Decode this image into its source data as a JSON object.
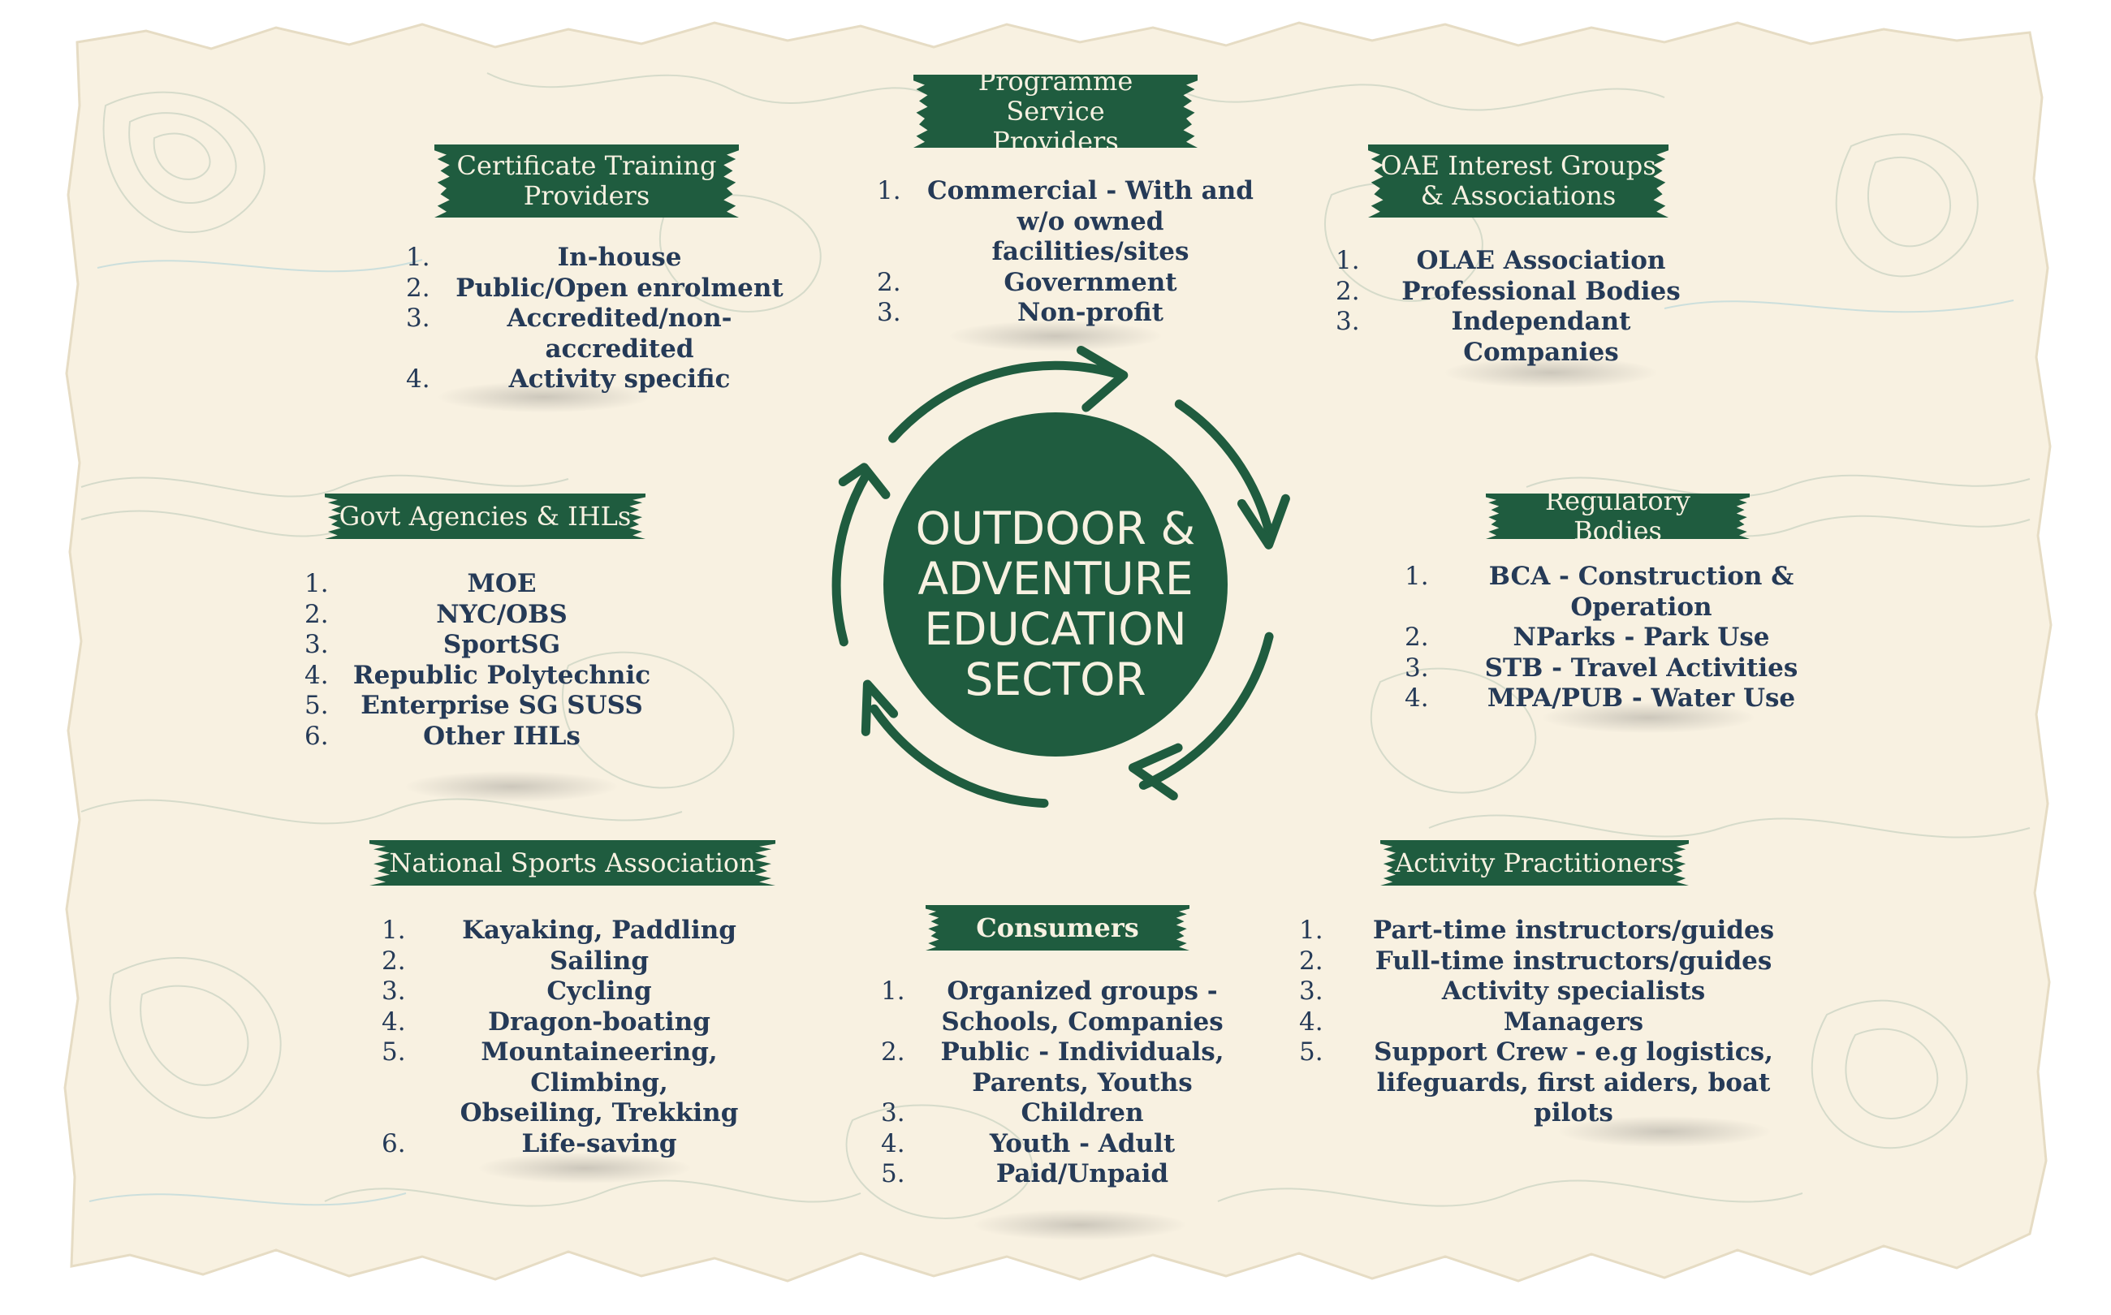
{
  "colors": {
    "paper": "#f8f1e1",
    "banner": "#1f5c3f",
    "text": "#253a57",
    "banner_text": "#f7f1e1",
    "contour": "#b9c9b8"
  },
  "center": {
    "title": "OUTDOOR &\nADVENTURE\nEDUCATION\nSECTOR"
  },
  "groups": {
    "programme": {
      "title": "Programme Service\nProviders",
      "items": [
        "Commercial - With and\nw/o owned facilities/sites",
        "Government",
        "Non-profit"
      ]
    },
    "certificate": {
      "title": "Certificate Training\nProviders",
      "items": [
        "In-house",
        "Public/Open enrolment",
        "Accredited/non-accredited",
        "Activity specific"
      ]
    },
    "oae": {
      "title": "OAE Interest Groups\n& Associations",
      "items": [
        "OLAE Association",
        "Professional Bodies",
        "Independant Companies"
      ]
    },
    "govt": {
      "title": "Govt Agencies & IHLs",
      "items": [
        "MOE",
        "NYC/OBS",
        "SportSG",
        "Republic Polytechnic",
        "Enterprise SG SUSS",
        "Other IHLs"
      ]
    },
    "regulatory": {
      "title": "Regulatory Bodies",
      "items": [
        "BCA - Construction & Operation",
        "NParks - Park Use",
        "STB - Travel Activities",
        "MPA/PUB - Water Use"
      ]
    },
    "nsa": {
      "title": "National Sports Association",
      "items": [
        "Kayaking, Paddling",
        "Sailing",
        "Cycling",
        "Dragon-boating",
        "Mountaineering, Climbing,\nObseiling, Trekking",
        "Life-saving"
      ]
    },
    "consumers": {
      "title": "Consumers",
      "items": [
        "Organized groups -\nSchools, Companies",
        "Public - Individuals,\nParents, Youths",
        "Children",
        "Youth - Adult",
        "Paid/Unpaid"
      ]
    },
    "practitioners": {
      "title": "Activity Practitioners",
      "items": [
        "Part-time instructors/guides",
        "Full-time instructors/guides",
        "Activity specialists",
        "Managers",
        "Support Crew - e.g logistics,\nlifeguards, first aiders, boat pilots"
      ]
    }
  }
}
